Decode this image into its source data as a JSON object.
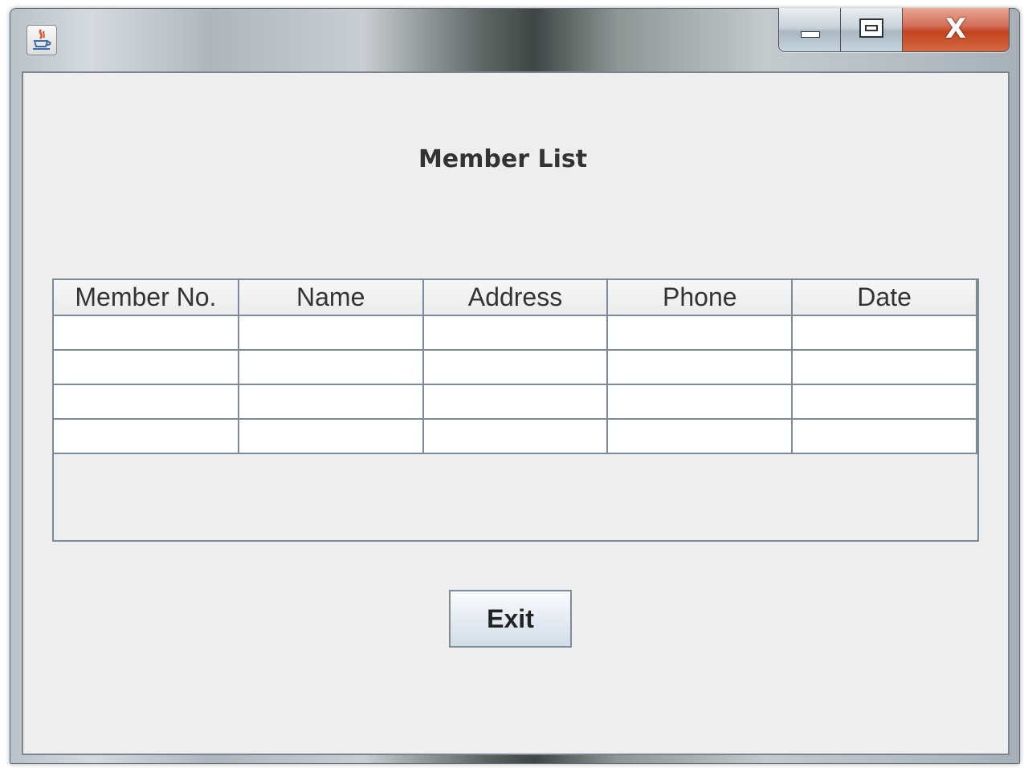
{
  "window": {
    "app_icon": "java-coffee-icon",
    "caption_buttons": {
      "minimize_icon": "minimize-icon",
      "maximize_icon": "maximize-icon",
      "close_icon": "close-icon",
      "close_label": "X"
    }
  },
  "main": {
    "heading": "Member List",
    "table": {
      "columns": [
        "Member No.",
        "Name",
        "Address",
        "Phone",
        "Date"
      ],
      "rows": [
        [
          "",
          "",
          "",
          "",
          ""
        ],
        [
          "",
          "",
          "",
          "",
          ""
        ],
        [
          "",
          "",
          "",
          "",
          ""
        ],
        [
          "",
          "",
          "",
          "",
          ""
        ]
      ]
    },
    "exit_label": "Exit"
  },
  "colors": {
    "panel_background": "#eeeeee",
    "grid_line": "#7d8a99",
    "close_button": "#c3431f"
  }
}
